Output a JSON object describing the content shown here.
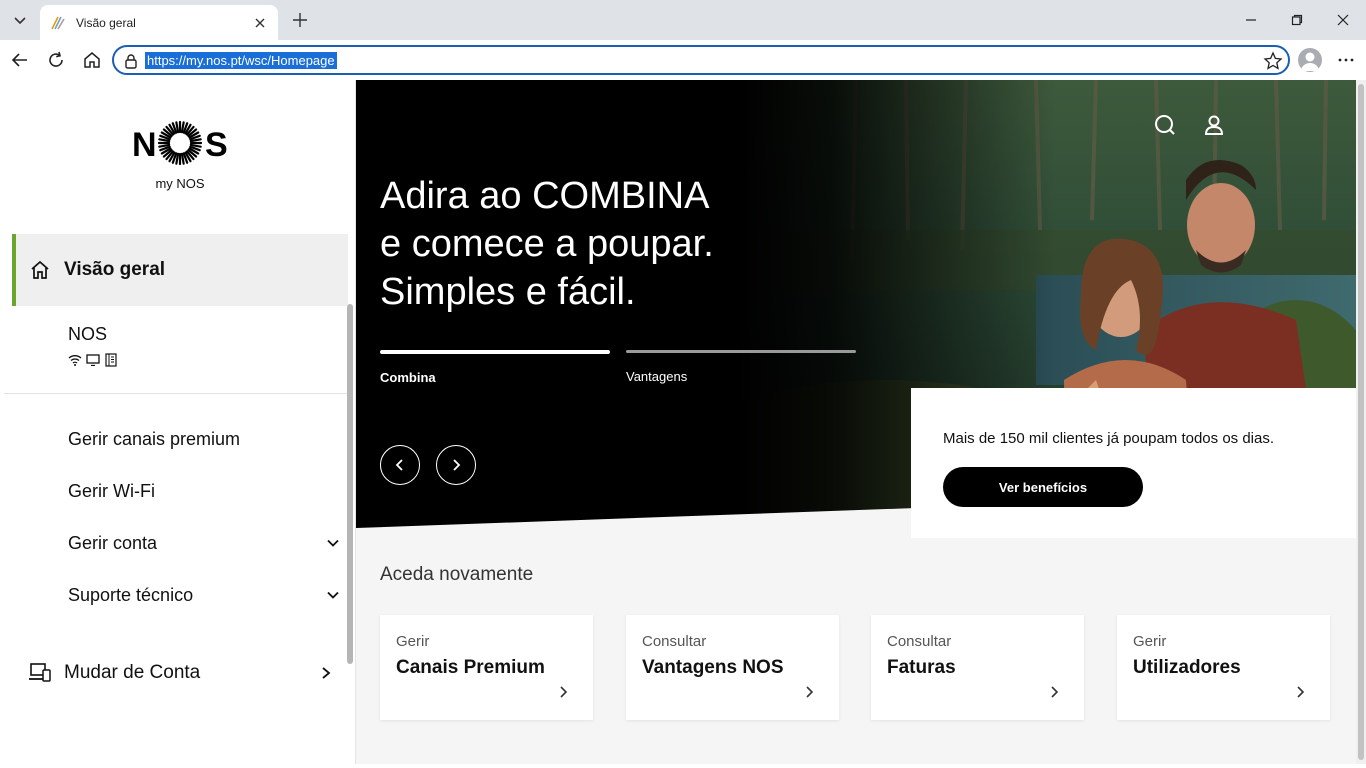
{
  "browser": {
    "tab_title": "Visão geral",
    "url": "https://my.nos.pt/wsc/Homepage"
  },
  "sidebar": {
    "logo_text_left": "N",
    "logo_text_right": "S",
    "logo_sub": "my NOS",
    "active_item": "Visão geral",
    "account_name": "NOS",
    "account_icons": [
      "wifi-icon",
      "tv-icon",
      "phone-icon"
    ],
    "menu": [
      {
        "label": "Gerir canais premium",
        "has_chevron": false
      },
      {
        "label": "Gerir Wi-Fi",
        "has_chevron": false
      },
      {
        "label": "Gerir conta",
        "has_chevron": true
      },
      {
        "label": "Suporte técnico",
        "has_chevron": true
      }
    ],
    "switch_account": "Mudar de Conta",
    "accent_color": "#6aa52e"
  },
  "hero": {
    "title_lines": [
      "Adira ao COMBINA",
      "e comece a poupar.",
      "Simples e fácil."
    ],
    "tabs": [
      {
        "label": "Combina",
        "active": true
      },
      {
        "label": "Vantagens",
        "active": false
      }
    ],
    "promo_text": "Mais de 150 mil clientes já poupam todos os dias.",
    "promo_button": "Ver benefícios"
  },
  "quick_access": {
    "title": "Aceda novamente",
    "cards": [
      {
        "kicker": "Gerir",
        "title": "Canais Premium"
      },
      {
        "kicker": "Consultar",
        "title": "Vantagens NOS"
      },
      {
        "kicker": "Consultar",
        "title": "Faturas"
      },
      {
        "kicker": "Gerir",
        "title": "Utilizadores"
      }
    ]
  }
}
